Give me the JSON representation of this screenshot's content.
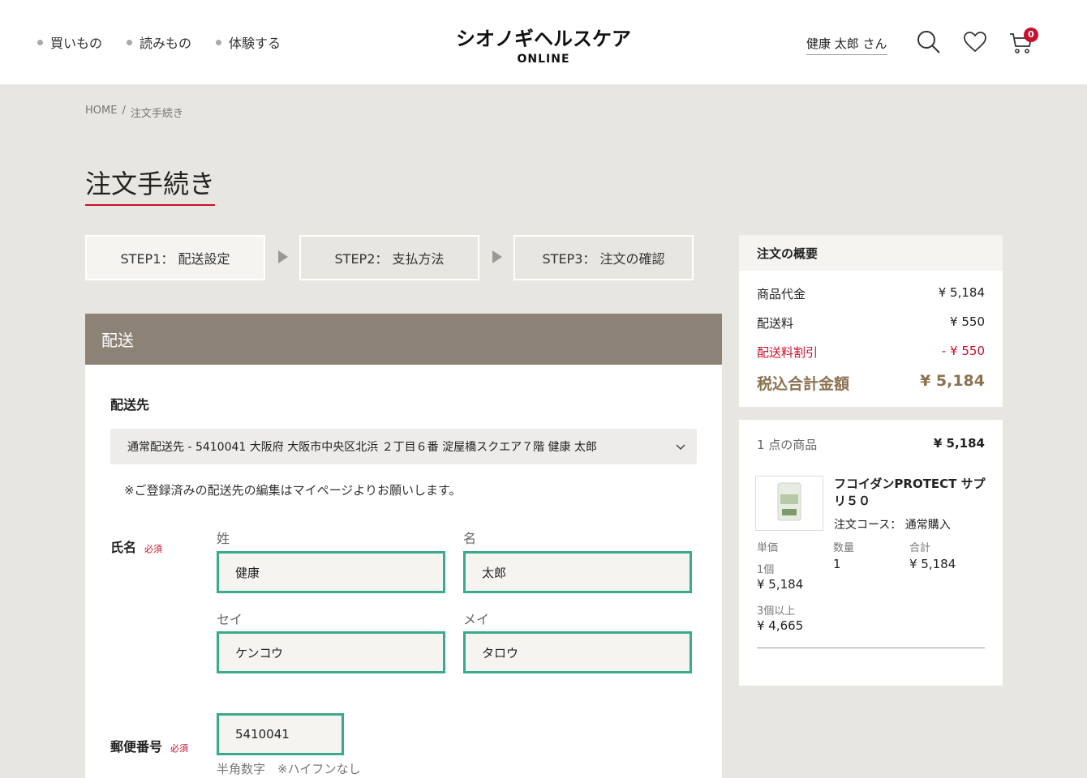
{
  "nav": {
    "items": [
      {
        "label": "買いもの"
      },
      {
        "label": "読みもの"
      },
      {
        "label": "体験する"
      }
    ]
  },
  "logo": {
    "main": "シオノギヘルスケア",
    "sub": "ONLINE"
  },
  "user": {
    "name": "健康 太郎 さん"
  },
  "cart": {
    "count": "0"
  },
  "breadcrumb": {
    "home": "HOME",
    "sep": "/",
    "current": "注文手続き"
  },
  "page": {
    "title": "注文手続き"
  },
  "steps": [
    {
      "label": "STEP1： 配送設定"
    },
    {
      "label": "STEP2： 支払方法"
    },
    {
      "label": "STEP3： 注文の確認"
    }
  ],
  "shipping": {
    "section_title": "配送",
    "destination_label": "配送先",
    "destination_value": "通常配送先 - 5410041 大阪府 大阪市中央区北浜 ２丁目６番 淀屋橋スクエア７階 健康 太郎",
    "note": "※ご登録済みの配送先の編集はマイページよりお願いします。",
    "name_label": "氏名",
    "required": "必須",
    "last_name_label": "姓",
    "last_name": "健康",
    "first_name_label": "名",
    "first_name": "太郎",
    "last_kana_label": "セイ",
    "last_kana": "ケンコウ",
    "first_kana_label": "メイ",
    "first_kana": "タロウ",
    "postal_label": "郵便番号",
    "postal": "5410041",
    "postal_hint": "半角数字　※ハイフンなし"
  },
  "summary": {
    "title": "注文の概要",
    "rows": [
      {
        "label": "商品代金",
        "value": "¥ 5,184"
      },
      {
        "label": "配送料",
        "value": "¥ 550"
      },
      {
        "label": "配送料割引",
        "value": "- ¥ 550"
      }
    ],
    "total_label": "税込合計金額",
    "total_value": "¥ 5,184"
  },
  "product": {
    "count_label": "1 点の商品",
    "total": "¥ 5,184",
    "name": "フコイダンPROTECT サプリ５０",
    "course": "注文コース： 通常購入",
    "unit_price_label": "単価",
    "qty_label": "数量",
    "subtotal_label": "合計",
    "tier1_label": "1個",
    "tier1_price": "¥ 5,184",
    "tier2_label": "3個以上",
    "tier2_price": "¥ 4,665",
    "qty": "1",
    "subtotal": "¥ 5,184"
  },
  "colors": {
    "accent_red": "#c8102e",
    "field_border": "#3aaa8c",
    "panel_head": "#8c8276",
    "total_gold": "#8c7350"
  }
}
